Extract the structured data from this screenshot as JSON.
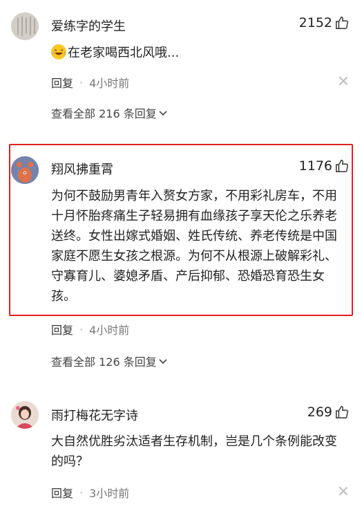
{
  "comments": [
    {
      "username": "爱练字的学生",
      "likes": "2152",
      "text": "在老家喝西北风哦...",
      "emoji": "laughing-tears-emoji",
      "reply_label": "回复",
      "separator": "·",
      "time": "4小时前",
      "view_all": "查看全部 216 条回复"
    },
    {
      "username": "翔风拂重霄",
      "likes": "1176",
      "text": "为何不鼓励男青年入赘女方家，不用彩礼房车，不用十月怀胎疼痛生子轻易拥有血缘孩子享天伦之乐养老送终。女性出嫁式婚姻、姓氏传统、养老传统是中国家庭不愿生女孩之根源。为何不从根源上破解彩礼、守寡育儿、婆媳矛盾、产后抑郁、恐婚恐育恐生女孩。",
      "reply_label": "回复",
      "separator": "·",
      "time": "4小时前",
      "view_all": "查看全部 126 条回复",
      "highlight_color": "#e02020"
    },
    {
      "username": "雨打梅花无字诗",
      "likes": "269",
      "text": "大自然优胜劣汰适者生存机制，岂是几个条例能改变的吗？",
      "reply_label": "回复",
      "separator": "·",
      "time": "3小时前"
    }
  ]
}
